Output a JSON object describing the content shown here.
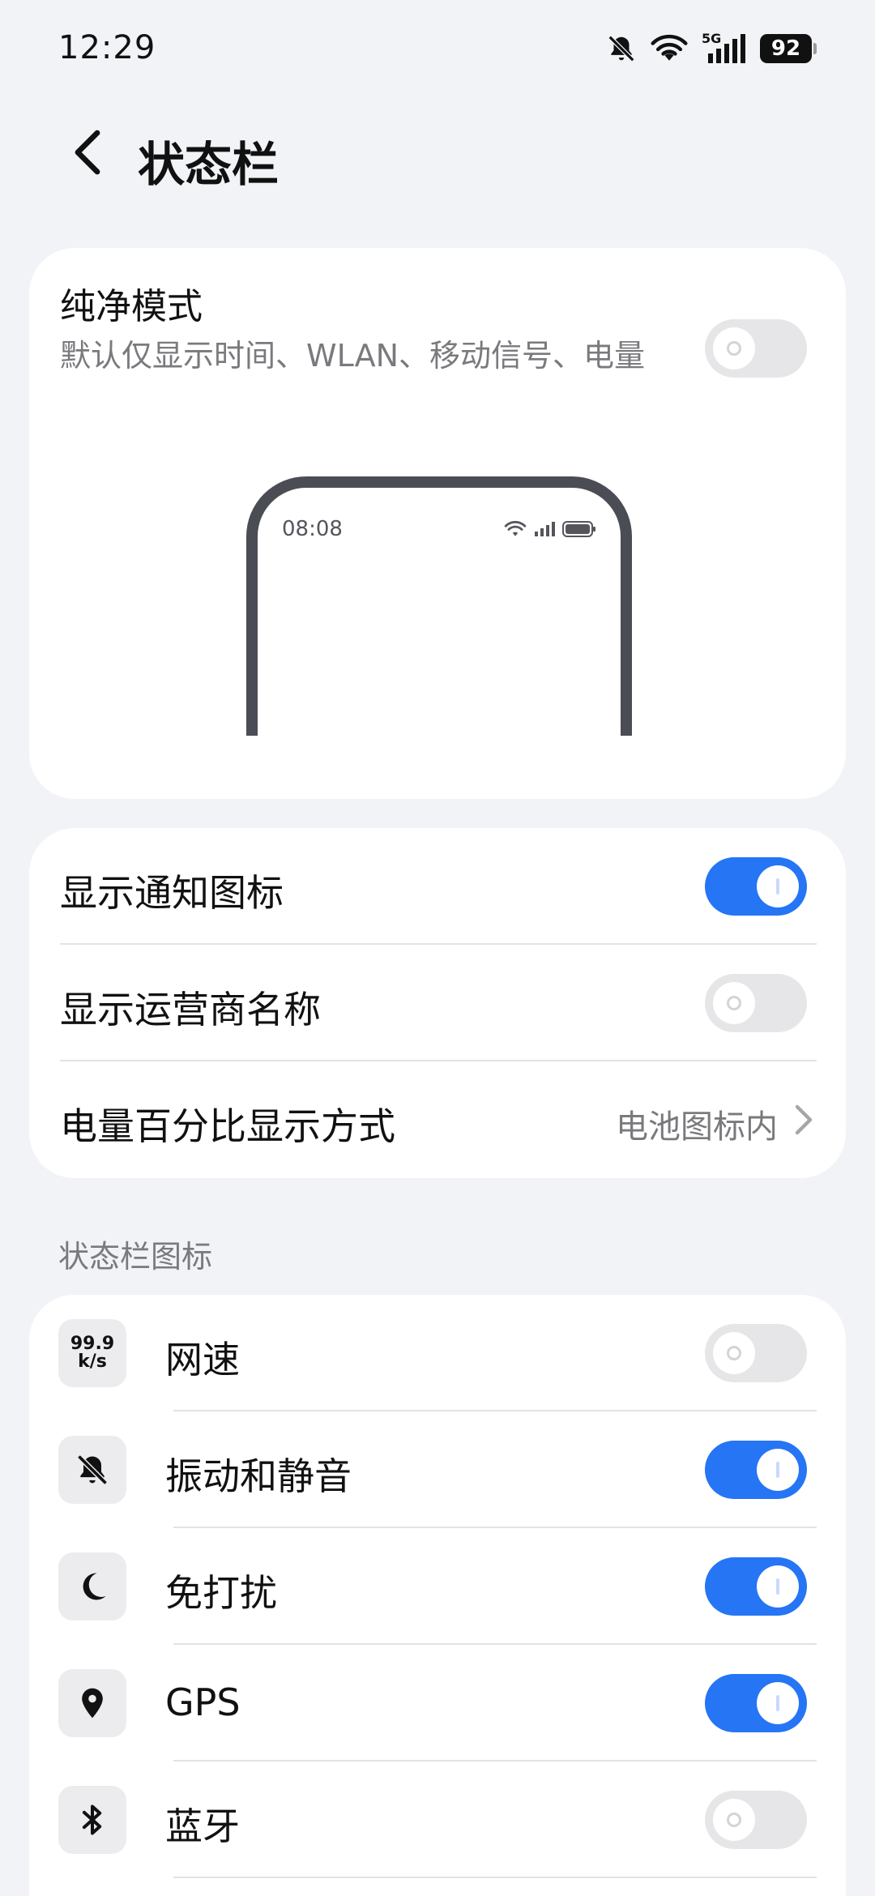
{
  "status_bar": {
    "time": "12:29",
    "network_label": "5G",
    "battery_level": "92",
    "icons": [
      "bell-muted-icon",
      "wifi-icon",
      "cellular-signal-icon",
      "battery-icon"
    ]
  },
  "header": {
    "title": "状态栏"
  },
  "pure_mode": {
    "title": "纯净模式",
    "description": "默认仅显示时间、WLAN、移动信号、电量",
    "enabled": false,
    "preview_time": "08:08"
  },
  "notify_settings": [
    {
      "label": "显示通知图标",
      "enabled": true
    },
    {
      "label": "显示运营商名称",
      "enabled": false
    },
    {
      "label": "电量百分比显示方式",
      "value": "电池图标内"
    }
  ],
  "section_title": "状态栏图标",
  "status_icons": [
    {
      "label": "网速",
      "icon": "network-speed-icon",
      "icon_text_top": "99.9",
      "icon_text_bottom": "k/s",
      "enabled": false
    },
    {
      "label": "振动和静音",
      "icon": "bell-muted-icon",
      "enabled": true
    },
    {
      "label": "免打扰",
      "icon": "moon-icon",
      "enabled": true
    },
    {
      "label": "GPS",
      "icon": "location-pin-icon",
      "enabled": true
    },
    {
      "label": "蓝牙",
      "icon": "bluetooth-icon",
      "enabled": false
    }
  ],
  "colors": {
    "accent": "#2575f5",
    "background": "#f1f3f7",
    "card": "#ffffff",
    "secondary_text": "#7a7a7e"
  }
}
